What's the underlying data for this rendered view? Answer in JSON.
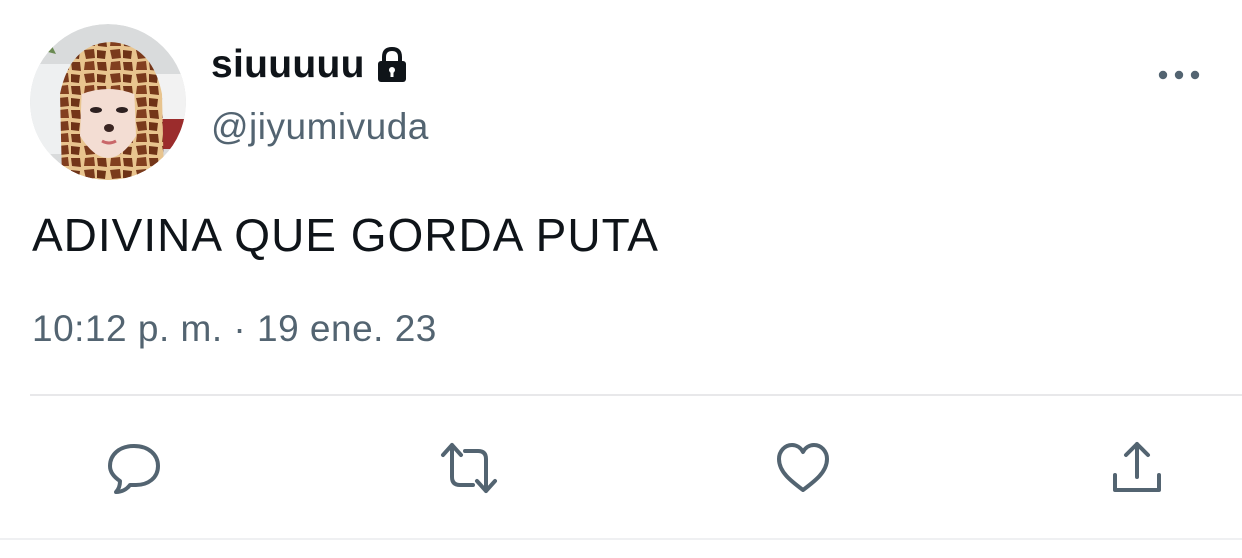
{
  "tweet": {
    "display_name": "siuuuuu",
    "handle": "@jiyumivuda",
    "text": "ADIVINA QUE GORDA PUTA",
    "time": "10:12 p. m.",
    "separator": "·",
    "date": "19 ene. 23"
  },
  "icons": {
    "account": "lock-icon",
    "more": "more-options-icon",
    "reply": "reply-icon",
    "retweet": "retweet-icon",
    "like": "like-icon",
    "share": "share-icon"
  },
  "colors": {
    "text_primary": "#0f1419",
    "text_secondary": "#536471",
    "icon": "#536471",
    "divider": "#e8e8ea"
  }
}
